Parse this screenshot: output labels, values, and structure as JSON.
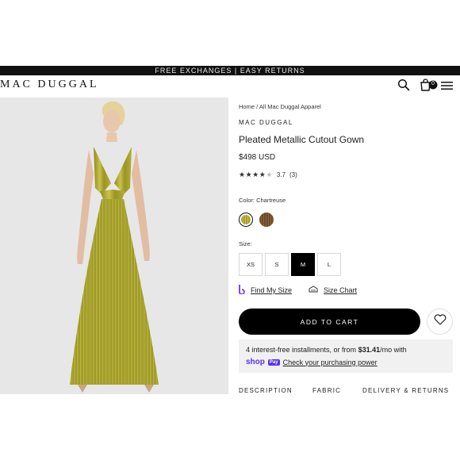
{
  "banner": {
    "text": "FREE EXCHANGES | EASY RETURNS"
  },
  "header": {
    "logo": "MAC DUGGAL",
    "cart_count": "0"
  },
  "breadcrumb": {
    "home": "Home",
    "separator": "/",
    "category": "All Mac Duggal Apparel"
  },
  "product": {
    "brand": "MAC DUGGAL",
    "title": "Pleated Metallic Cutout Gown",
    "price": "$498 USD",
    "rating_value": 3.7,
    "rating_text": "3.7",
    "reviews": "(3)",
    "color_label": "Color: Chartreuse",
    "colors": [
      {
        "name": "chartreuse",
        "hex": "#a7a02a"
      },
      {
        "name": "bronze",
        "hex": "#6b4a26"
      }
    ],
    "size_label": "Size:",
    "sizes": [
      "XS",
      "S",
      "M",
      "L"
    ],
    "selected_size": "M"
  },
  "links": {
    "find_size": "Find My Size",
    "size_chart": "Size Chart"
  },
  "cart": {
    "label": "ADD TO CART"
  },
  "shoppay": {
    "line1_prefix": "4 interest-free installments, or from ",
    "amount": "$31.41",
    "line1_suffix": "/mo with",
    "logo": "shop",
    "pay": "Pay",
    "link": "Check your purchasing power"
  },
  "tabs": [
    "DESCRIPTION",
    "FABRIC",
    "DELIVERY & RETURNS"
  ],
  "colors": {
    "primary": "#000000",
    "shoppay": "#5a31f4",
    "gown": "#a7a02a",
    "photo_bg": "#e7e7e7"
  }
}
